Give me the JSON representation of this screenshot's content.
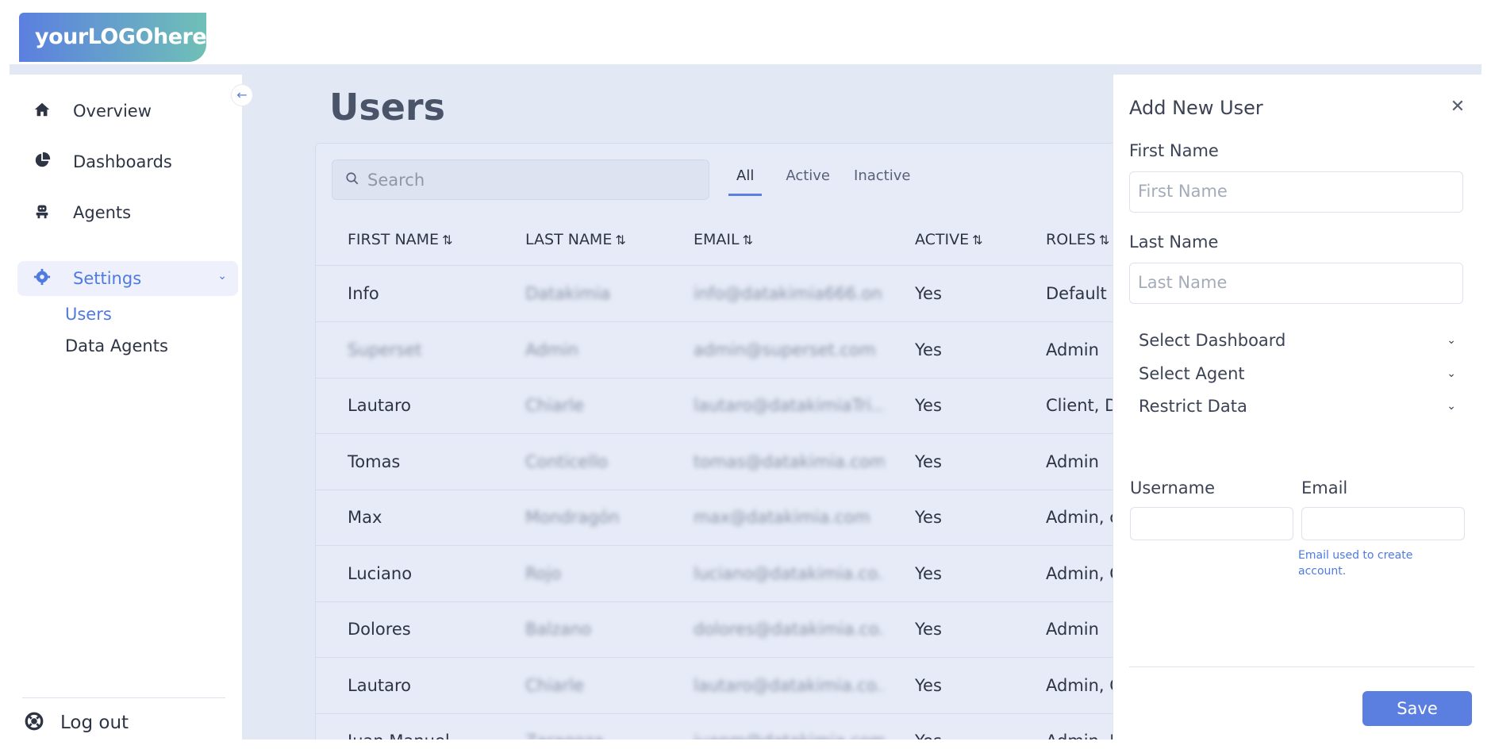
{
  "logo": {
    "text": "yourLOGOhere"
  },
  "sidebar": {
    "items": [
      {
        "label": "Overview",
        "icon": "home-icon"
      },
      {
        "label": "Dashboards",
        "icon": "pie-chart-icon"
      },
      {
        "label": "Agents",
        "icon": "robot-icon"
      },
      {
        "label": "Settings",
        "icon": "gear-icon",
        "expanded": true
      }
    ],
    "subitems": [
      {
        "label": "Users",
        "active": true
      },
      {
        "label": "Data Agents",
        "active": false
      }
    ],
    "logout_label": "Log out"
  },
  "main": {
    "title": "Users",
    "search_placeholder": "Search",
    "tabs": [
      "All",
      "Active",
      "Inactive"
    ],
    "active_tab": "All",
    "columns": [
      "FIRST NAME",
      "LAST NAME",
      "EMAIL",
      "ACTIVE",
      "ROLES"
    ],
    "rows": [
      {
        "first": "Info",
        "last": "Datakimia",
        "email": "info@datakimia666.on...",
        "active": "Yes",
        "roles": "Default"
      },
      {
        "first": "Superset",
        "last": "Admin",
        "email": "admin@superset.com",
        "active": "Yes",
        "roles": "Admin"
      },
      {
        "first": "Lautaro",
        "last": "Chiarle",
        "email": "lautaro@datakimiaTri...",
        "active": "Yes",
        "roles": "Client, D"
      },
      {
        "first": "Tomas",
        "last": "Conticello",
        "email": "tomas@datakimia.com",
        "active": "Yes",
        "roles": "Admin"
      },
      {
        "first": "Max",
        "last": "Mondragón",
        "email": "max@datakimia.com",
        "active": "Yes",
        "roles": "Admin, c"
      },
      {
        "first": "Luciano",
        "last": "Rojo",
        "email": "luciano@datakimia.co...",
        "active": "Yes",
        "roles": "Admin, C"
      },
      {
        "first": "Dolores",
        "last": "Balzano",
        "email": "dolores@datakimia.co...",
        "active": "Yes",
        "roles": "Admin"
      },
      {
        "first": "Lautaro",
        "last": "Chiarle",
        "email": "lautaro@datakimia.co...",
        "active": "Yes",
        "roles": "Admin, C"
      },
      {
        "first": "Juan Manuel",
        "last": "Zaragoza",
        "email": "juanm@datakimia.com",
        "active": "Yes",
        "roles": "Admin, D"
      }
    ]
  },
  "panel": {
    "title": "Add New User",
    "first_name_label": "First Name",
    "first_name_placeholder": "First Name",
    "last_name_label": "Last Name",
    "last_name_placeholder": "Last Name",
    "selects": [
      "Select Dashboard",
      "Select Agent",
      "Restrict Data"
    ],
    "username_label": "Username",
    "email_label": "Email",
    "email_helper": "Email used to create account.",
    "save_label": "Save"
  },
  "colors": {
    "accent": "#5b7fe0",
    "main_bg": "#e3e8f5",
    "text": "#2d3444"
  }
}
